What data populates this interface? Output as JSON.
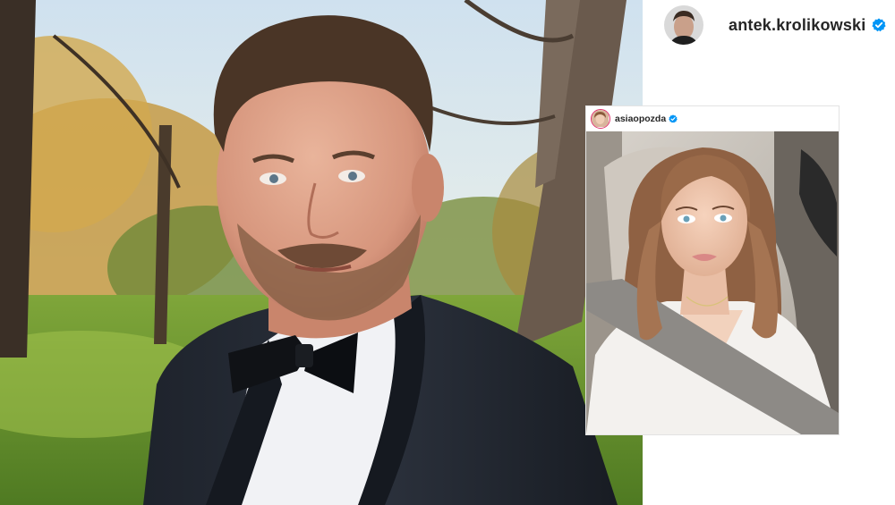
{
  "profile": {
    "username": "antek.krolikowski",
    "verified_icon": "verified-badge-icon"
  },
  "story": {
    "username": "asiaopozda",
    "verified_icon": "verified-badge-icon"
  },
  "colors": {
    "verified_blue": "#0095f6",
    "username_text": "#262626",
    "story_ring": "#e1306c"
  }
}
